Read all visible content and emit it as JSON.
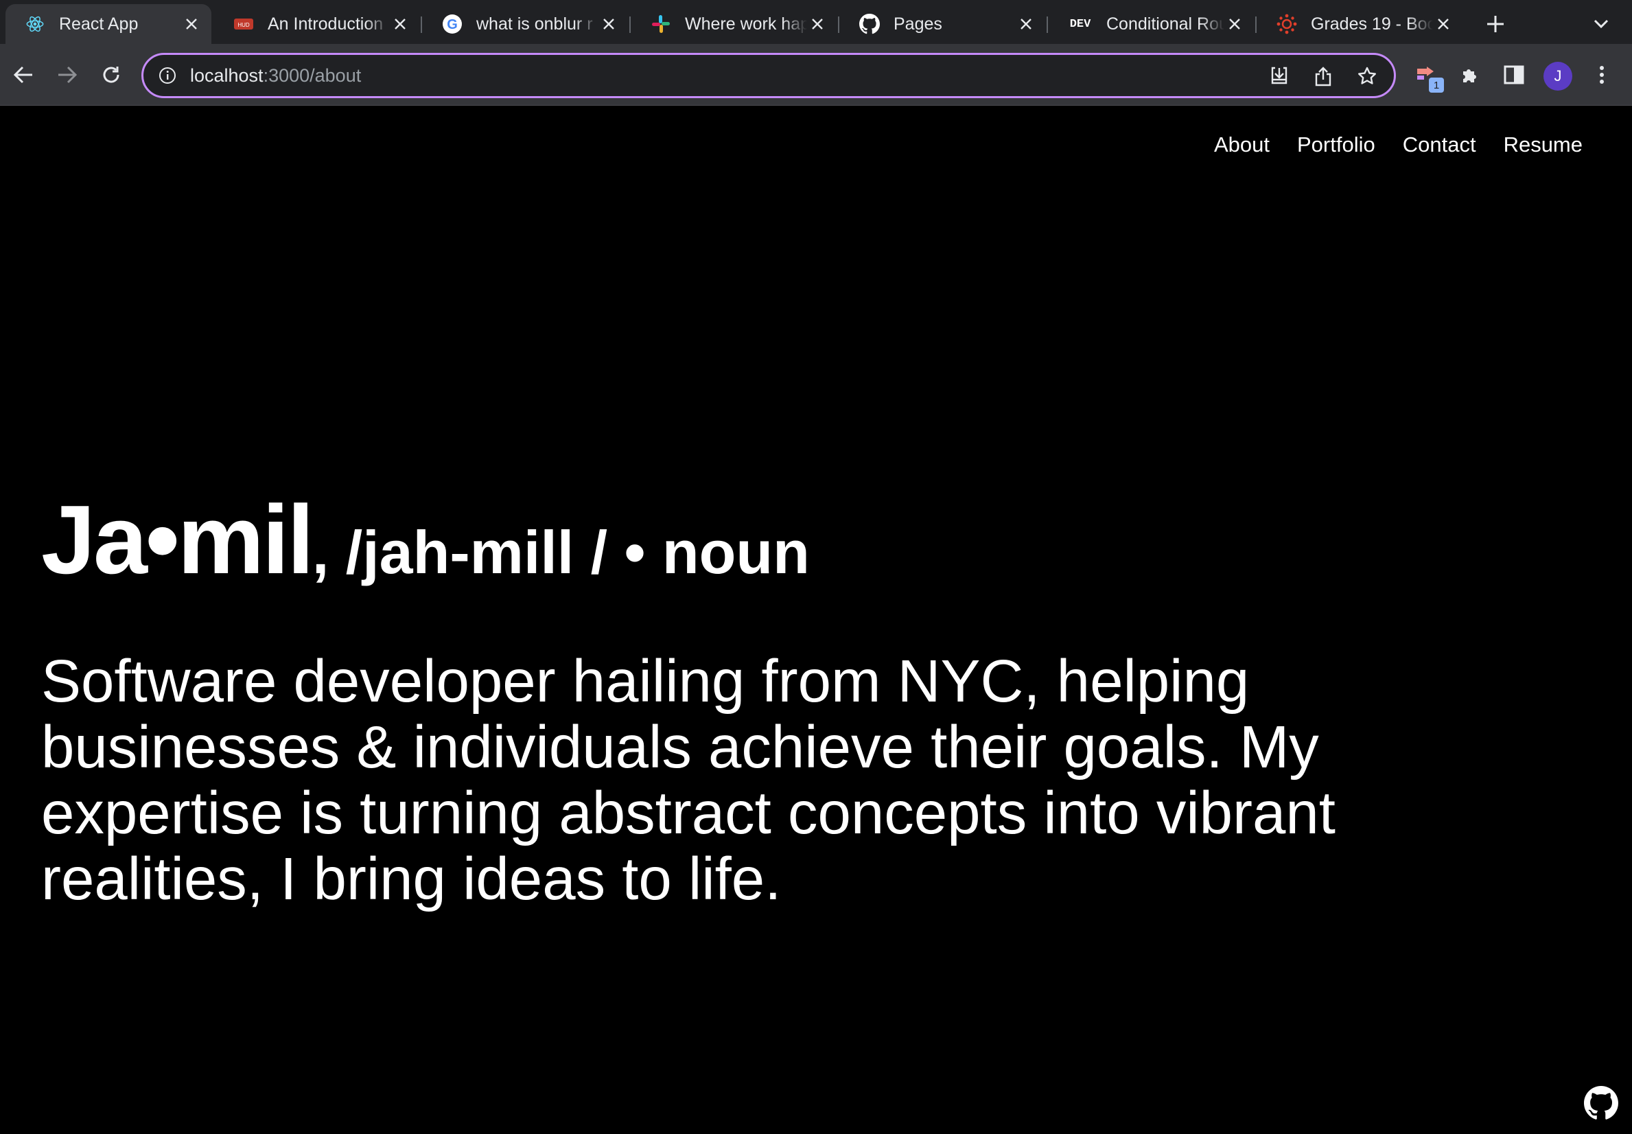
{
  "browser": {
    "tabs": [
      {
        "title": "React App",
        "icon": "react-icon",
        "active": true
      },
      {
        "title": "An Introduction",
        "icon": "hud-icon"
      },
      {
        "title": "what is onblur r",
        "icon": "google-icon"
      },
      {
        "title": "Where work hap",
        "icon": "slack-icon"
      },
      {
        "title": "Pages",
        "icon": "github-icon"
      },
      {
        "title": "Conditional Rou",
        "icon": "dev-icon",
        "icon_text": "DEV"
      },
      {
        "title": "Grades 19 - Boo",
        "icon": "canvas-icon"
      }
    ],
    "address": {
      "host": "localhost",
      "path": ":3000/about"
    },
    "extension_badge": "1",
    "profile_initial": "J",
    "omnibox_border_color": "#c58af9",
    "avatar_color": "#5b3cc4"
  },
  "site": {
    "nav": [
      "About",
      "Portfolio",
      "Contact",
      "Resume"
    ],
    "word": "Ja•mil",
    "pronunciation": ", /jah-mill / • noun",
    "bio": "Software developer hailing from NYC, helping businesses & individuals achieve their goals. My expertise is turning abstract concepts into vibrant realities, I bring ideas to life."
  }
}
